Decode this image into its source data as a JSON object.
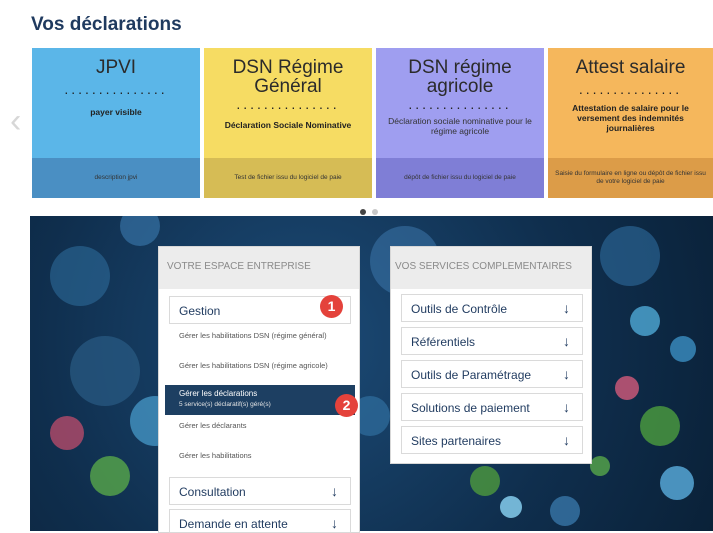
{
  "page": {
    "title": "Vos déclarations"
  },
  "carousel": {
    "cards": [
      {
        "title": "JPVI",
        "dots": "...............",
        "subtitle": "payer visible",
        "footer": "description jpvi"
      },
      {
        "title": "DSN Régime Général",
        "dots": "...............",
        "subtitle": "Déclaration Sociale Nominative",
        "footer": "Test de fichier issu du logiciel de paie"
      },
      {
        "title": "DSN régime agricole",
        "dots": "...............",
        "subtitle": "Déclaration sociale nominative pour le régime agricole",
        "footer": "dépôt de fichier issu du logiciel de paie"
      },
      {
        "title": "Attest salaire",
        "dots": "...............",
        "subtitle": "Attestation de salaire pour le versement des indemnités journalières",
        "footer": "Saisie du formulaire en ligne ou dépôt de fichier issu de votre logiciel de paie"
      }
    ],
    "prev_icon": "chevron-left-icon"
  },
  "espace": {
    "title": "VOTRE ESPACE ENTREPRISE",
    "gestion": {
      "label": "Gestion",
      "badge": "1"
    },
    "links": [
      "Gérer les habilitations DSN (régime général)",
      "Gérer les habilitations DSN (régime agricole)"
    ],
    "active": {
      "label": "Gérer les déclarations",
      "sub": "5 service(s) déclaratif(s) géré(s)",
      "badge": "2"
    },
    "links2": [
      "Gérer les déclarants",
      "Gérer les habilitations"
    ],
    "consultation": "Consultation",
    "demande": "Demande en attente",
    "arrow": "↓"
  },
  "services": {
    "title": "VOS SERVICES COMPLEMENTAIRES",
    "items": [
      "Outils de Contrôle",
      "Référentiels",
      "Outils de Paramétrage",
      "Solutions de paiement",
      "Sites partenaires"
    ],
    "arrow": "↓"
  },
  "colors": {
    "brand_navy": "#1f3a5f",
    "badge_red": "#e4423b",
    "card_jpvi": "#5bb6e8",
    "card_dsn_general": "#f6dc63",
    "card_dsn_agricole": "#9f9ef0",
    "card_attest": "#f5b75c"
  }
}
